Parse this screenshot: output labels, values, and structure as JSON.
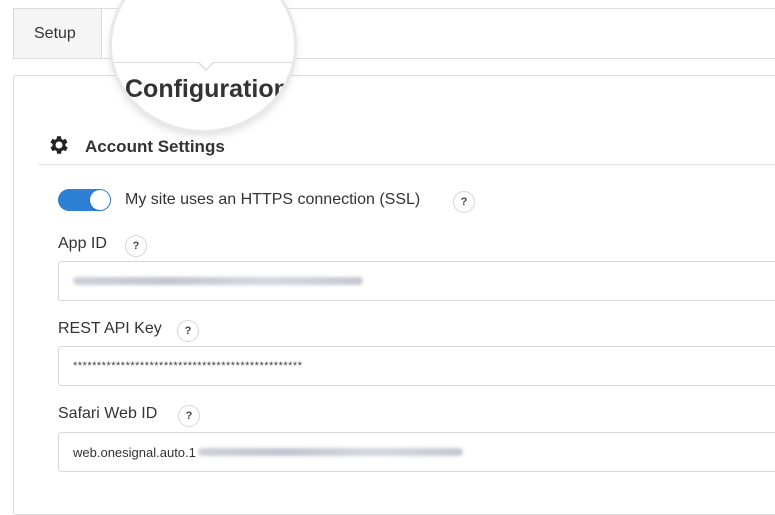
{
  "tabs": {
    "setup_label": "Setup",
    "configuration_label": "Configuration"
  },
  "section": {
    "title": "Account Settings",
    "icon": "gear-icon"
  },
  "ssl": {
    "label": "My site uses an HTTPS connection (SSL)",
    "enabled": true,
    "help": "?"
  },
  "app_id": {
    "label": "App ID",
    "help": "?"
  },
  "rest_api_key": {
    "label": "REST API Key",
    "help": "?",
    "value": "************************************************"
  },
  "safari_web_id": {
    "label": "Safari Web ID",
    "help": "?",
    "value_prefix": "web.onesignal.auto.1"
  },
  "colors": {
    "toggle_on": "#2e7fd6",
    "border": "#dcdcdc"
  }
}
